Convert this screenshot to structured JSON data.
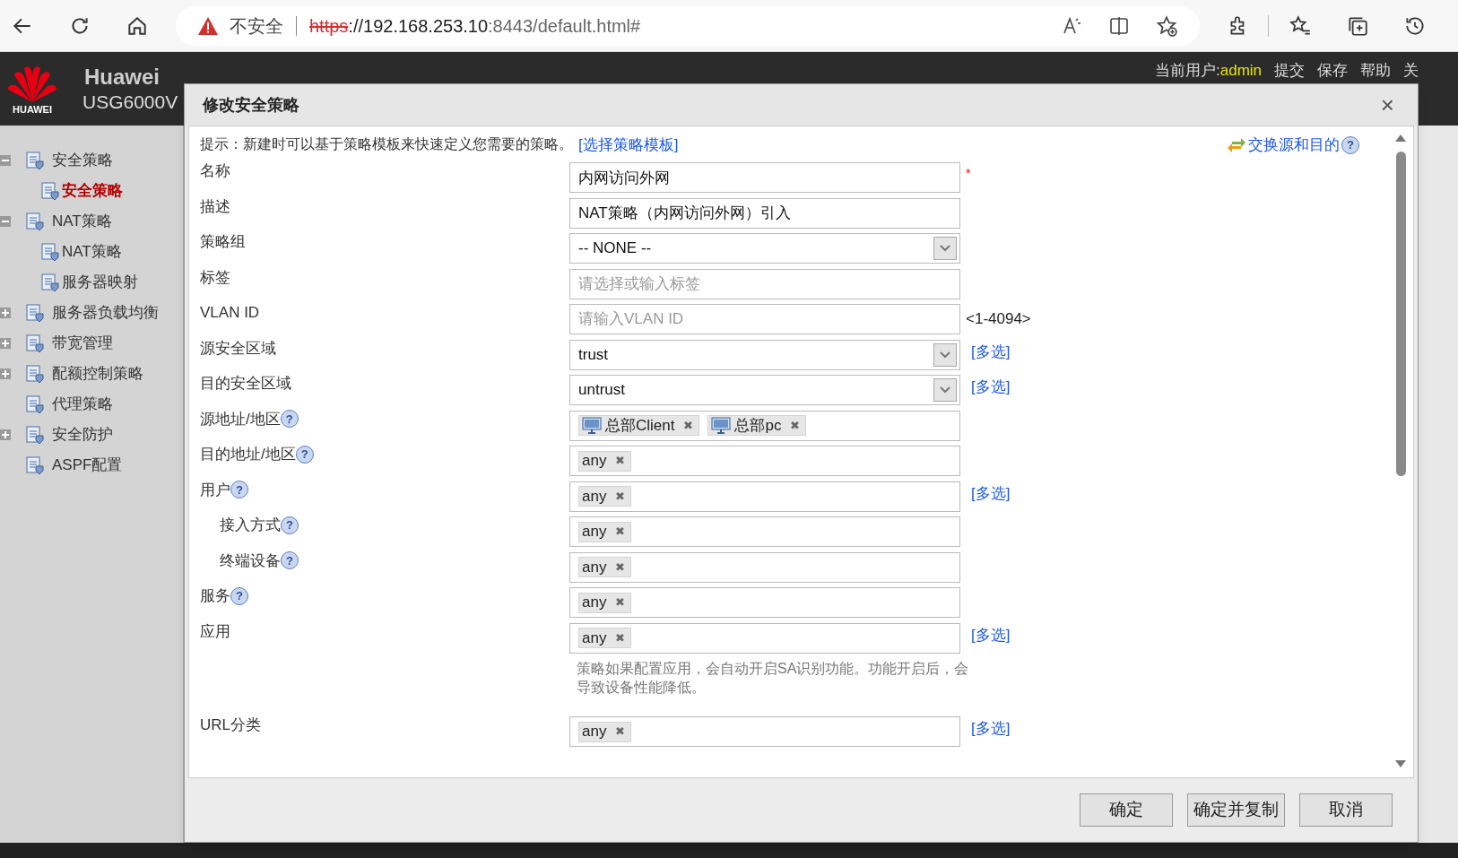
{
  "browser": {
    "security": "不安全",
    "url": [
      {
        "kind": "scheme",
        "text": "https"
      },
      {
        "kind": "host",
        "text": "://192.168.253.10"
      },
      {
        "kind": "path",
        "text": ":8443/default.html#"
      }
    ]
  },
  "header": {
    "logo": "HUAWEI",
    "brand": "Huawei",
    "model": "USG6000V",
    "user_label": "当前用户:",
    "user": "admin",
    "links": [
      "提交",
      "保存",
      "帮助",
      "关"
    ]
  },
  "sidebar": [
    {
      "label": "安全策略",
      "expanded": true,
      "selected": false,
      "children": [
        {
          "label": "安全策略",
          "selected": true
        }
      ]
    },
    {
      "label": "NAT策略",
      "expanded": true,
      "selected": false,
      "children": [
        {
          "label": "NAT策略",
          "selected": false
        },
        {
          "label": "服务器映射",
          "selected": false
        }
      ]
    },
    {
      "label": "服务器负载均衡",
      "expanded": false,
      "selected": false
    },
    {
      "label": "带宽管理",
      "expanded": false,
      "selected": false
    },
    {
      "label": "配额控制策略",
      "expanded": false,
      "selected": false
    },
    {
      "label": "代理策略",
      "selected": false
    },
    {
      "label": "安全防护",
      "expanded": false,
      "selected": false
    },
    {
      "label": "ASPF配置",
      "selected": false
    }
  ],
  "dialog": {
    "title": "修改安全策略",
    "close": "×",
    "hint": "提示：新建时可以基于策略模板来快速定义您需要的策略。",
    "hint_link": "[选择策略模板]",
    "swap_link": "交换源和目的",
    "swap_help": "?",
    "fields": [
      {
        "label": "名称",
        "kind": "text",
        "value": "内网访问外网",
        "required": "*"
      },
      {
        "label": "描述",
        "kind": "text",
        "value": "NAT策略（内网访问外网）引入"
      },
      {
        "label": "策略组",
        "kind": "select",
        "value": "-- NONE --"
      },
      {
        "label": "标签",
        "kind": "text",
        "placeholder": "请选择或输入标签"
      },
      {
        "label": "VLAN ID",
        "kind": "text",
        "placeholder": "请输入VLAN ID",
        "suffix": "<1-4094>"
      },
      {
        "label": "源安全区域",
        "kind": "select",
        "value": "trust",
        "link": "[多选]"
      },
      {
        "label": "目的安全区域",
        "kind": "select",
        "value": "untrust",
        "link": "[多选]"
      },
      {
        "label": "源地址/地区",
        "help": "?",
        "kind": "tags",
        "tags": [
          {
            "kind": "host",
            "text": "总部Client",
            "remove": "✖"
          },
          {
            "kind": "host",
            "text": "总部pc",
            "remove": "✖"
          }
        ]
      },
      {
        "label": "目的地址/地区",
        "help": "?",
        "kind": "tags",
        "tags": [
          {
            "kind": "plain",
            "text": "any",
            "remove": "✖"
          }
        ]
      },
      {
        "label": "用户",
        "help": "?",
        "kind": "tags",
        "tags": [
          {
            "kind": "plain",
            "text": "any",
            "remove": "✖"
          }
        ],
        "link": "[多选]",
        "children": [
          {
            "label": "接入方式",
            "help": "?",
            "kind": "tags",
            "tags": [
              {
                "kind": "plain",
                "text": "any",
                "remove": "✖"
              }
            ]
          },
          {
            "label": "终端设备",
            "help": "?",
            "kind": "tags",
            "tags": [
              {
                "kind": "plain",
                "text": "any",
                "remove": "✖"
              }
            ]
          }
        ]
      },
      {
        "label": "服务",
        "help": "?",
        "kind": "tags",
        "tags": [
          {
            "kind": "plain",
            "text": "any",
            "remove": "✖"
          }
        ]
      },
      {
        "label": "应用",
        "kind": "tags",
        "tags": [
          {
            "kind": "plain",
            "text": "any",
            "remove": "✖"
          }
        ],
        "link": "[多选]",
        "note": "策略如果配置应用，会自动开启SA识别功能。功能开启后，会导致设备性能降低。"
      },
      {
        "label": "URL分类",
        "kind": "tags",
        "tags": [
          {
            "kind": "plain",
            "text": "any",
            "remove": "✖"
          }
        ],
        "link": "[多选]"
      }
    ],
    "buttons": [
      "确定",
      "确定并复制",
      "取消"
    ]
  }
}
